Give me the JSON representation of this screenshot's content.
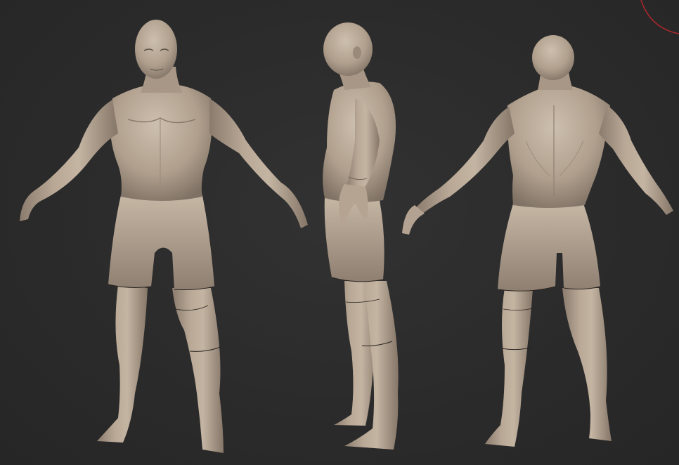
{
  "scene": {
    "background_color": "#2b2b2b",
    "clay_color": "#b3a291",
    "clay_shadow": "#7d6f62",
    "clay_highlight": "#d1c3b3",
    "gizmo_color": "#c0272d",
    "views": [
      {
        "name": "front-view"
      },
      {
        "name": "side-view"
      },
      {
        "name": "back-view"
      }
    ]
  }
}
